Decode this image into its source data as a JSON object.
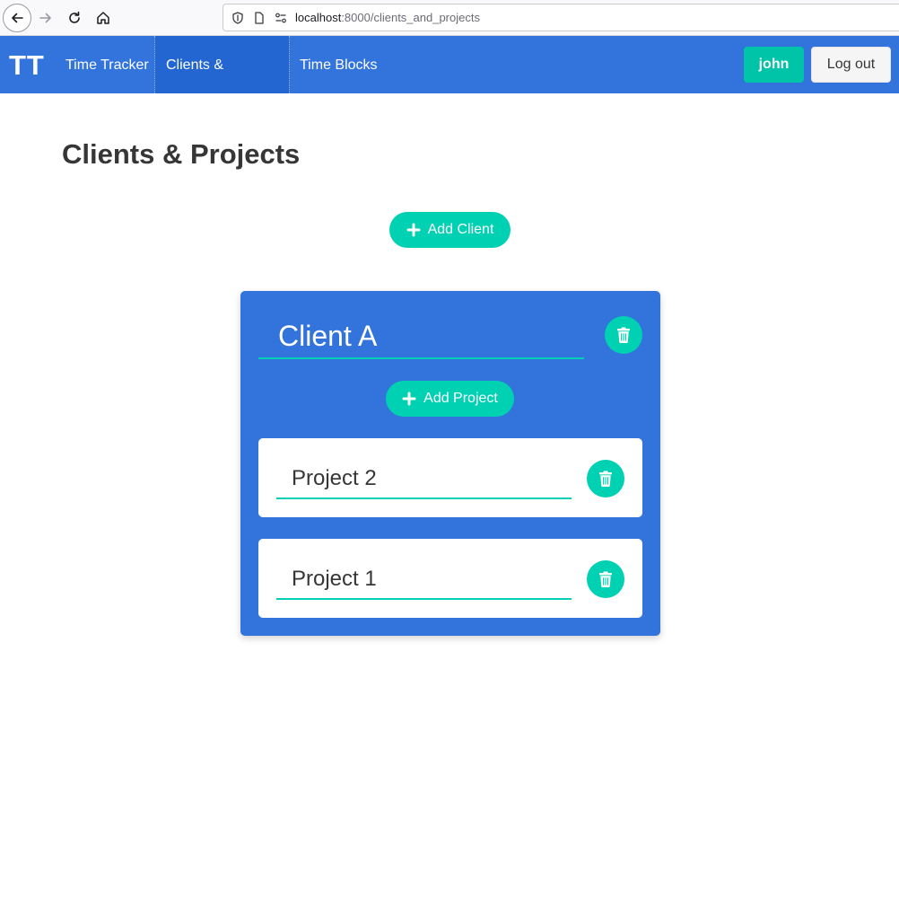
{
  "browser": {
    "url_host": "localhost",
    "url_path": ":8000/clients_and_projects"
  },
  "navbar": {
    "brand": "TT",
    "items": [
      {
        "label": "Time Tracker"
      },
      {
        "label": "Clients & Projects",
        "active": true
      },
      {
        "label": "Time Blocks"
      }
    ],
    "user_label": "john",
    "logout_label": "Log out"
  },
  "main": {
    "title": "Clients & Projects",
    "add_client_label": "Add Client",
    "clients": [
      {
        "name": "Client A",
        "add_project_label": "Add Project",
        "projects": [
          {
            "name": "Project 2"
          },
          {
            "name": "Project 1"
          }
        ]
      }
    ]
  },
  "colors": {
    "primary": "#3273dc",
    "accent": "#00d1b2",
    "user_button": "#00c4a7",
    "text_dark": "#363636"
  },
  "icons": {
    "add": "plus-icon",
    "delete": "trash-icon"
  }
}
